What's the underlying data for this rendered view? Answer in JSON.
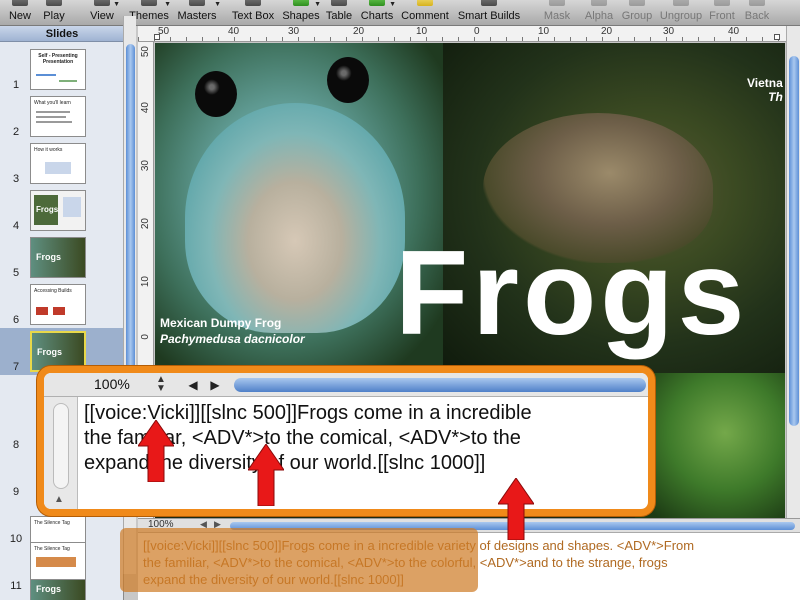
{
  "toolbar": {
    "items": [
      {
        "label": "New",
        "icon": "new-icon"
      },
      {
        "label": "Play",
        "icon": "play-icon"
      },
      {
        "label": "View",
        "icon": "view-icon"
      },
      {
        "label": "Themes",
        "icon": "themes-icon"
      },
      {
        "label": "Masters",
        "icon": "masters-icon"
      },
      {
        "label": "Text Box",
        "icon": "text-box-icon"
      },
      {
        "label": "Shapes",
        "icon": "shapes-icon"
      },
      {
        "label": "Table",
        "icon": "table-icon"
      },
      {
        "label": "Charts",
        "icon": "charts-icon"
      },
      {
        "label": "Comment",
        "icon": "comment-icon"
      },
      {
        "label": "Smart Builds",
        "icon": "smart-builds-icon"
      },
      {
        "label": "Mask",
        "icon": "mask-icon"
      },
      {
        "label": "Alpha",
        "icon": "alpha-icon"
      },
      {
        "label": "Group",
        "icon": "group-icon"
      },
      {
        "label": "Ungroup",
        "icon": "ungroup-icon"
      },
      {
        "label": "Front",
        "icon": "front-icon"
      },
      {
        "label": "Back",
        "icon": "back-icon"
      }
    ]
  },
  "slides_pane": {
    "title": "Slides",
    "slides": [
      {
        "number": "1",
        "title": "Self - Presenting Presentation"
      },
      {
        "number": "2",
        "title": "What you'll learn"
      },
      {
        "number": "3",
        "title": "How it works"
      },
      {
        "number": "4",
        "title": "Frogs"
      },
      {
        "number": "5",
        "title": "Frogs"
      },
      {
        "number": "6",
        "title": "Accessing Builds"
      },
      {
        "number": "7",
        "title": "Frogs"
      },
      {
        "number": "8",
        "title": ""
      },
      {
        "number": "9",
        "title": ""
      },
      {
        "number": "10",
        "title": "The Silence Tag"
      },
      {
        "number": "11",
        "title": "The Silence Tag"
      },
      {
        "number": "",
        "title": "Frogs"
      }
    ]
  },
  "ruler": {
    "top": [
      "50",
      "40",
      "30",
      "20",
      "10",
      "0",
      "10",
      "20",
      "30",
      "40"
    ],
    "left": [
      "50",
      "40",
      "30",
      "20",
      "10",
      "0",
      "10",
      "20",
      "30"
    ]
  },
  "slide": {
    "title": "Frogs",
    "caption_left_common": "Mexican Dumpy Frog",
    "caption_left_species": "Pachymedusa dacnicolor",
    "caption_right_common": "Vietna",
    "caption_right_species": "Th"
  },
  "zoom_panel": {
    "zoom": "100%",
    "text": "[[voice:Vicki]][[slnc 500]]Frogs come in a incredible\nthe familiar, <ADV*>to the comical, <ADV*>to the\nexpand the diversity of our world.[[slnc 1000]]"
  },
  "notes": {
    "zoom": "100%",
    "text": "[[voice:Vicki]][[slnc 500]]Frogs come in a incredible variety of designs and shapes. <ADV*>From\nthe familiar, <ADV*>to the comical, <ADV*>to the colorful, <ADV*>and to the strange, frogs\nexpand the diversity of our world.[[slnc 1000]]"
  },
  "colors": {
    "callout_border": "#f08a1a",
    "notes_highlight": "#cf7d28",
    "arrow": "#e81818",
    "selection": "#9cb0cd"
  }
}
